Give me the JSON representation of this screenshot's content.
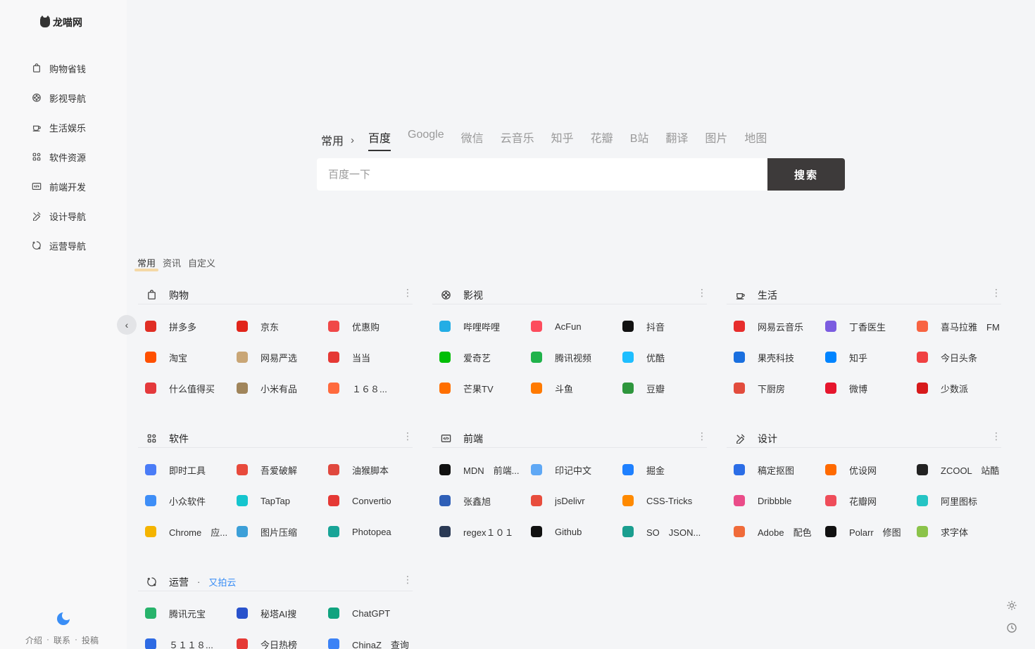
{
  "sidebar": {
    "logo": "龙喵网",
    "items": [
      {
        "label": "购物省钱",
        "icon": "bag-icon"
      },
      {
        "label": "影视导航",
        "icon": "film-reel-icon"
      },
      {
        "label": "生活娱乐",
        "icon": "coffee-cup-icon"
      },
      {
        "label": "软件资源",
        "icon": "grid-apps-icon"
      },
      {
        "label": "前端开发",
        "icon": "code-window-icon"
      },
      {
        "label": "设计导航",
        "icon": "design-tools-icon"
      },
      {
        "label": "运营导航",
        "icon": "operations-icon"
      }
    ],
    "footer": [
      "介绍",
      "·",
      "联系",
      "·",
      "投稿"
    ]
  },
  "search": {
    "category": "常用",
    "engines": [
      "百度",
      "Google",
      "微信",
      "云音乐",
      "知乎",
      "花瓣",
      "B站",
      "翻译",
      "图片",
      "地图"
    ],
    "active_engine": "百度",
    "placeholder": "百度一下",
    "button": "搜索"
  },
  "section_tabs": [
    "常用",
    "资讯",
    "自定义"
  ],
  "cards": [
    {
      "title": "购物",
      "icon": "bag-icon",
      "links": [
        {
          "name": "拼多多",
          "color": "#e02e24"
        },
        {
          "name": "京东",
          "color": "#e1251b"
        },
        {
          "name": "优惠购",
          "color": "#f04848"
        },
        {
          "name": "淘宝",
          "color": "#ff5000"
        },
        {
          "name": "网易严选",
          "color": "#c9a676"
        },
        {
          "name": "当当",
          "color": "#e53935"
        },
        {
          "name": "什么值得买",
          "color": "#e4393c"
        },
        {
          "name": "小米有品",
          "color": "#a0855b"
        },
        {
          "name": "１６８...",
          "color": "#ff6a3d"
        }
      ]
    },
    {
      "title": "影视",
      "icon": "film-reel-icon",
      "links": [
        {
          "name": "哔哩哔哩",
          "color": "#23ade5"
        },
        {
          "name": "AcFun",
          "color": "#fd4c5d"
        },
        {
          "name": "抖音",
          "color": "#111111"
        },
        {
          "name": "爱奇艺",
          "color": "#00be06"
        },
        {
          "name": "腾讯视频",
          "color": "#20b24b"
        },
        {
          "name": "优酷",
          "color": "#1ebeff"
        },
        {
          "name": "芒果TV",
          "color": "#ff6f00"
        },
        {
          "name": "斗鱼",
          "color": "#ff7a00"
        },
        {
          "name": "豆瓣",
          "color": "#2e963d"
        }
      ]
    },
    {
      "title": "生活",
      "icon": "coffee-cup-icon",
      "links": [
        {
          "name": "网易云音乐",
          "color": "#e72d2c"
        },
        {
          "name": "丁香医生",
          "color": "#7b5ce0"
        },
        {
          "name": "喜马拉雅　FM",
          "color": "#f86442"
        },
        {
          "name": "果壳科技",
          "color": "#1a6fdf"
        },
        {
          "name": "知乎",
          "color": "#0084ff"
        },
        {
          "name": "今日头条",
          "color": "#f04142"
        },
        {
          "name": "下厨房",
          "color": "#e24c3d"
        },
        {
          "name": "微博",
          "color": "#e6162d"
        },
        {
          "name": "少数派",
          "color": "#d71a1b"
        }
      ]
    },
    {
      "title": "软件",
      "icon": "grid-apps-icon",
      "links": [
        {
          "name": "即时工具",
          "color": "#4a7cf7"
        },
        {
          "name": "吾爱破解",
          "color": "#e84a3c"
        },
        {
          "name": "油猴脚本",
          "color": "#e0483e"
        },
        {
          "name": "小众软件",
          "color": "#3e8ef7"
        },
        {
          "name": "TapTap",
          "color": "#15c5ce"
        },
        {
          "name": "Convertio",
          "color": "#e53935"
        },
        {
          "name": "Chrome　应...",
          "color": "#f4b400"
        },
        {
          "name": "图片压缩",
          "color": "#3c9fd8"
        },
        {
          "name": "Photopea",
          "color": "#18a497"
        }
      ]
    },
    {
      "title": "前端",
      "icon": "code-window-icon",
      "links": [
        {
          "name": "MDN　前端...",
          "color": "#111111"
        },
        {
          "name": "印记中文",
          "color": "#5fa8f5"
        },
        {
          "name": "掘金",
          "color": "#1e80ff"
        },
        {
          "name": "张鑫旭",
          "color": "#2f5fb7"
        },
        {
          "name": "jsDelivr",
          "color": "#e84d3d"
        },
        {
          "name": "CSS-Tricks",
          "color": "#ff8a00"
        },
        {
          "name": "regex１０１",
          "color": "#2b3a55"
        },
        {
          "name": "Github",
          "color": "#111111"
        },
        {
          "name": "SO　JSON...",
          "color": "#1a9e8f"
        }
      ]
    },
    {
      "title": "设计",
      "icon": "design-tools-icon",
      "links": [
        {
          "name": "稿定抠图",
          "color": "#2b6de6"
        },
        {
          "name": "优设网",
          "color": "#ff6a00"
        },
        {
          "name": "ZCOOL　站酷",
          "color": "#222222"
        },
        {
          "name": "Dribbble",
          "color": "#ea4c89"
        },
        {
          "name": "花瓣网",
          "color": "#ef4d5a"
        },
        {
          "name": "阿里图标",
          "color": "#25c4c4"
        },
        {
          "name": "Adobe　配色",
          "color": "#f06b3a"
        },
        {
          "name": "Polarr　修图",
          "color": "#111111"
        },
        {
          "name": "求字体",
          "color": "#8bc34a"
        }
      ]
    },
    {
      "title": "运营",
      "icon": "operations-icon",
      "sub_dot": "·",
      "sub": "又拍云",
      "links": [
        {
          "name": "腾讯元宝",
          "color": "#27b36b"
        },
        {
          "name": "秘塔AI搜",
          "color": "#2952cc"
        },
        {
          "name": "ChatGPT",
          "color": "#10a37f"
        },
        {
          "name": "５１１８...",
          "color": "#2d6ae3"
        },
        {
          "name": "今日热榜",
          "color": "#e53935"
        },
        {
          "name": "ChinaZ　查询",
          "color": "#3b82f6"
        }
      ]
    }
  ]
}
